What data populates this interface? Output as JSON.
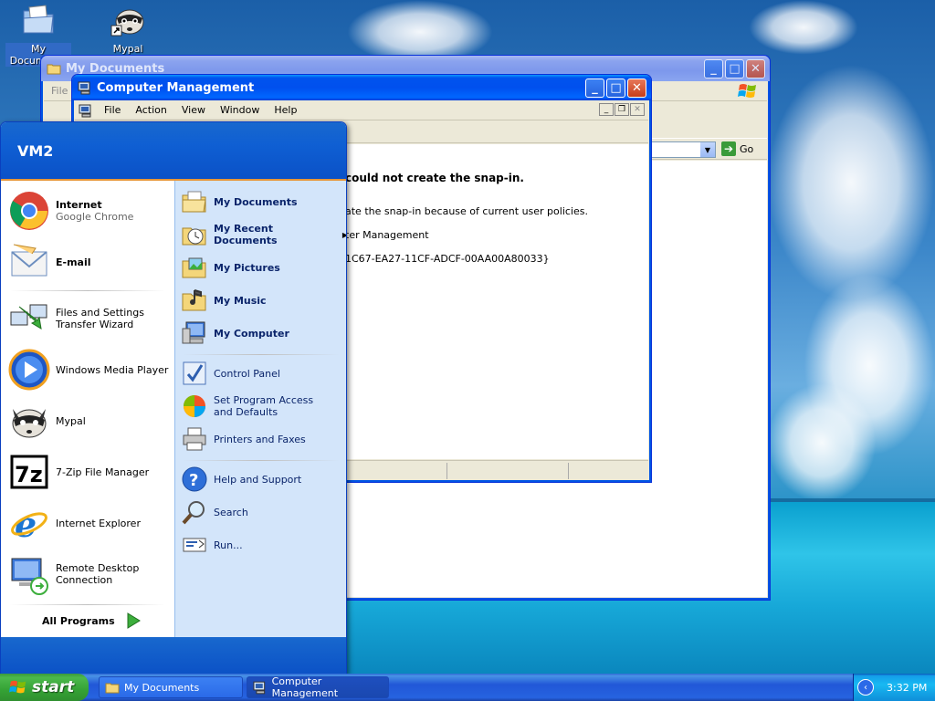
{
  "desktop": {
    "icons": [
      {
        "label": "My Documents"
      },
      {
        "label": "Mypal"
      }
    ]
  },
  "my_documents_window": {
    "title": "My Documents",
    "menu_first": "File",
    "go_label": "Go"
  },
  "computer_management_window": {
    "title": "Computer Management",
    "menu": [
      "File",
      "Action",
      "View",
      "Window",
      "Help"
    ],
    "error": {
      "heading": "could not create the snap-in.",
      "line1": "ate the snap-in because of current user policies.",
      "line2": "ter Management",
      "line3": "1C67-EA27-11CF-ADCF-00AA00A80033}"
    }
  },
  "start_menu": {
    "user": "VM2",
    "pinned": [
      {
        "title": "Internet",
        "subtitle": "Google Chrome"
      },
      {
        "title": "E-mail",
        "subtitle": ""
      }
    ],
    "recent": [
      {
        "label": "Files and Settings Transfer Wizard"
      },
      {
        "label": "Windows Media Player"
      },
      {
        "label": "Mypal"
      },
      {
        "label": "7-Zip File Manager"
      },
      {
        "label": "Internet Explorer"
      },
      {
        "label": "Remote Desktop Connection"
      }
    ],
    "all_programs": "All Programs",
    "places": [
      {
        "label": "My Documents"
      },
      {
        "label": "My Recent Documents"
      },
      {
        "label": "My Pictures"
      },
      {
        "label": "My Music"
      },
      {
        "label": "My Computer"
      }
    ],
    "settings": [
      {
        "label": "Control Panel"
      },
      {
        "label": "Set Program Access and Defaults"
      },
      {
        "label": "Printers and Faxes"
      }
    ],
    "help": [
      {
        "label": "Help and Support"
      },
      {
        "label": "Search"
      },
      {
        "label": "Run..."
      }
    ]
  },
  "taskbar": {
    "start_label": "start",
    "tasks": [
      {
        "label": "My Documents"
      },
      {
        "label": "Computer Management"
      }
    ],
    "clock": "3:32 PM"
  }
}
